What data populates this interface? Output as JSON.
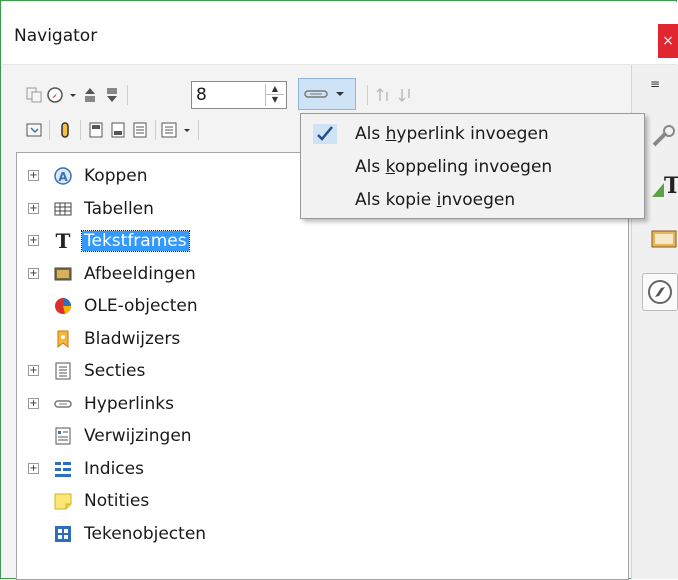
{
  "window": {
    "title": "Navigator",
    "close_label": "×"
  },
  "toolbar": {
    "spin_value": "8"
  },
  "menu": {
    "items": [
      {
        "pre": "Als ",
        "u": "h",
        "post": "yperlink invoegen",
        "checked": true
      },
      {
        "pre": "Als ",
        "u": "k",
        "post": "oppeling invoegen",
        "checked": false
      },
      {
        "pre": "Als kopie ",
        "u": "i",
        "post": "nvoegen",
        "checked": false
      }
    ]
  },
  "tree": {
    "items": [
      {
        "label": "Koppen",
        "icon": "headings-icon",
        "expander": true
      },
      {
        "label": "Tabellen",
        "icon": "table-icon",
        "expander": true
      },
      {
        "label": "Tekstframes",
        "icon": "text-frame-icon",
        "expander": true,
        "selected": true
      },
      {
        "label": "Afbeeldingen",
        "icon": "image-icon",
        "expander": true
      },
      {
        "label": "OLE-objecten",
        "icon": "ole-object-icon",
        "expander": false
      },
      {
        "label": "Bladwijzers",
        "icon": "bookmark-icon",
        "expander": false
      },
      {
        "label": "Secties",
        "icon": "section-icon",
        "expander": true
      },
      {
        "label": "Hyperlinks",
        "icon": "hyperlink-icon",
        "expander": true
      },
      {
        "label": "Verwijzingen",
        "icon": "reference-icon",
        "expander": false
      },
      {
        "label": "Indices",
        "icon": "index-icon",
        "expander": true
      },
      {
        "label": "Notities",
        "icon": "comment-icon",
        "expander": false
      },
      {
        "label": "Tekenobjecten",
        "icon": "drawing-object-icon",
        "expander": false
      }
    ]
  },
  "colors": {
    "window_border": "#3f9b4c",
    "close_button": "#e0262e",
    "selection": "#3399ff"
  }
}
